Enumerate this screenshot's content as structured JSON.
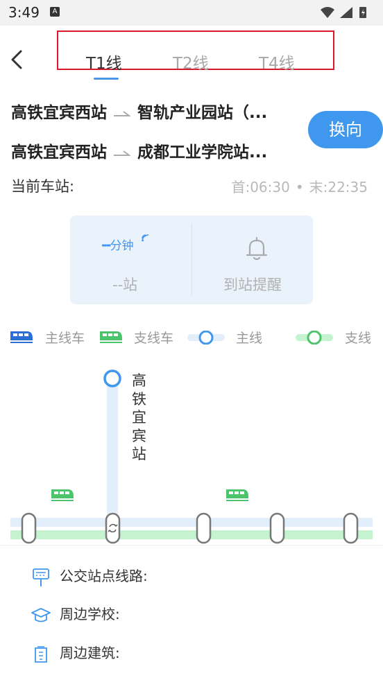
{
  "status_bar": {
    "time": "3:49",
    "notification_letter": "A"
  },
  "tabs": [
    {
      "label": "T1线",
      "active": true
    },
    {
      "label": "T2线",
      "active": false
    },
    {
      "label": "T4线",
      "active": false
    }
  ],
  "routes": [
    {
      "from": "高铁宜宾西站",
      "to": "智轨产业园站（..."
    },
    {
      "from": "高铁宜宾西站",
      "to": "成都工业学院站..."
    }
  ],
  "swap_label": "换向",
  "current_station_label": "当前车站:",
  "schedule": {
    "first": "首:06:30",
    "separator": "•",
    "last": "末:22:35"
  },
  "arrival": {
    "minutes": "--",
    "unit": "分钟",
    "stations": "--站",
    "remind_label": "到站提醒"
  },
  "legend": {
    "main_train": "主线车",
    "branch_train": "支线车",
    "main_line": "主线",
    "branch_line": "支线"
  },
  "colors": {
    "accent": "#3f97ee",
    "main_line": "#e2eefa",
    "branch_line": "#c5f2cf",
    "branch_train": "#4cc46b",
    "main_train": "#2b6fd6"
  },
  "map": {
    "station_name": "高铁宜宾站",
    "station_name_chars": [
      "高",
      "铁",
      "宜",
      "宾",
      "站"
    ]
  },
  "info": {
    "bus": "公交站点线路:",
    "school": "周边学校:",
    "building": "周边建筑:"
  }
}
